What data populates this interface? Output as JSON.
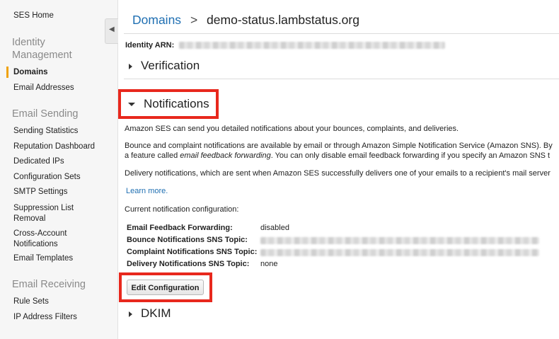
{
  "sidebar": {
    "home": "SES Home",
    "identity_heading": "Identity Management",
    "identity_items": [
      "Domains",
      "Email Addresses"
    ],
    "sending_heading": "Email Sending",
    "sending_items": [
      "Sending Statistics",
      "Reputation Dashboard",
      "Dedicated IPs",
      "Configuration Sets",
      "SMTP Settings",
      "Suppression List Removal",
      "Cross-Account Notifications",
      "Email Templates"
    ],
    "receiving_heading": "Email Receiving",
    "receiving_items": [
      "Rule Sets",
      "IP Address Filters"
    ],
    "active_item": "Domains",
    "active_color": "#f0a20c"
  },
  "breadcrumb": {
    "parent": "Domains",
    "separator": ">",
    "current": "demo-status.lambstatus.org"
  },
  "identity_arn_label": "Identity ARN:",
  "sections": {
    "verification": "Verification",
    "notifications": "Notifications",
    "dkim": "DKIM"
  },
  "notifications": {
    "intro": "Amazon SES can send you detailed notifications about your bounces, complaints, and deliveries.",
    "bounce_para_line1": "Bounce and complaint notifications are available by email or through Amazon Simple Notification Service (Amazon SNS). By",
    "bounce_para_line2_pre": "a feature called ",
    "bounce_para_line2_em": "email feedback forwarding",
    "bounce_para_line2_post": ". You can only disable email feedback forwarding if you specify an Amazon SNS t",
    "delivery_para": "Delivery notifications, which are sent when Amazon SES successfully delivers one of your emails to a recipient's mail server",
    "learn_more": "Learn more.",
    "current_config_label": "Current notification configuration:",
    "config": [
      {
        "label": "Email Feedback Forwarding:",
        "value": "disabled"
      },
      {
        "label": "Bounce Notifications SNS Topic:",
        "value": ""
      },
      {
        "label": "Complaint Notifications SNS Topic:",
        "value": ""
      },
      {
        "label": "Delivery Notifications SNS Topic:",
        "value": "none"
      }
    ],
    "edit_button": "Edit Configuration"
  },
  "colors": {
    "link": "#1f6fb2",
    "highlight_box": "#e8281d"
  },
  "icons": {
    "collapse": "chevron-left-icon",
    "expand_closed": "caret-right-icon",
    "expand_open": "caret-down-icon"
  }
}
